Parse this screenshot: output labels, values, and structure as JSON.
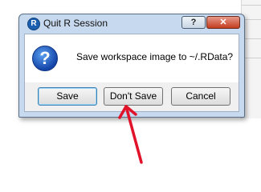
{
  "dialog": {
    "title": "Quit R Session",
    "title_icon": "r-logo",
    "help_label": "?",
    "close_label": "✕",
    "message": "Save workspace image to ~/.RData?",
    "message_icon": "question-icon",
    "buttons": {
      "save": "Save",
      "dont_save": "Don't Save",
      "cancel": "Cancel"
    }
  },
  "colors": {
    "window_frame": "#c7d9ee",
    "close_button": "#c43c1f",
    "annotation_arrow": "#e0132b"
  }
}
